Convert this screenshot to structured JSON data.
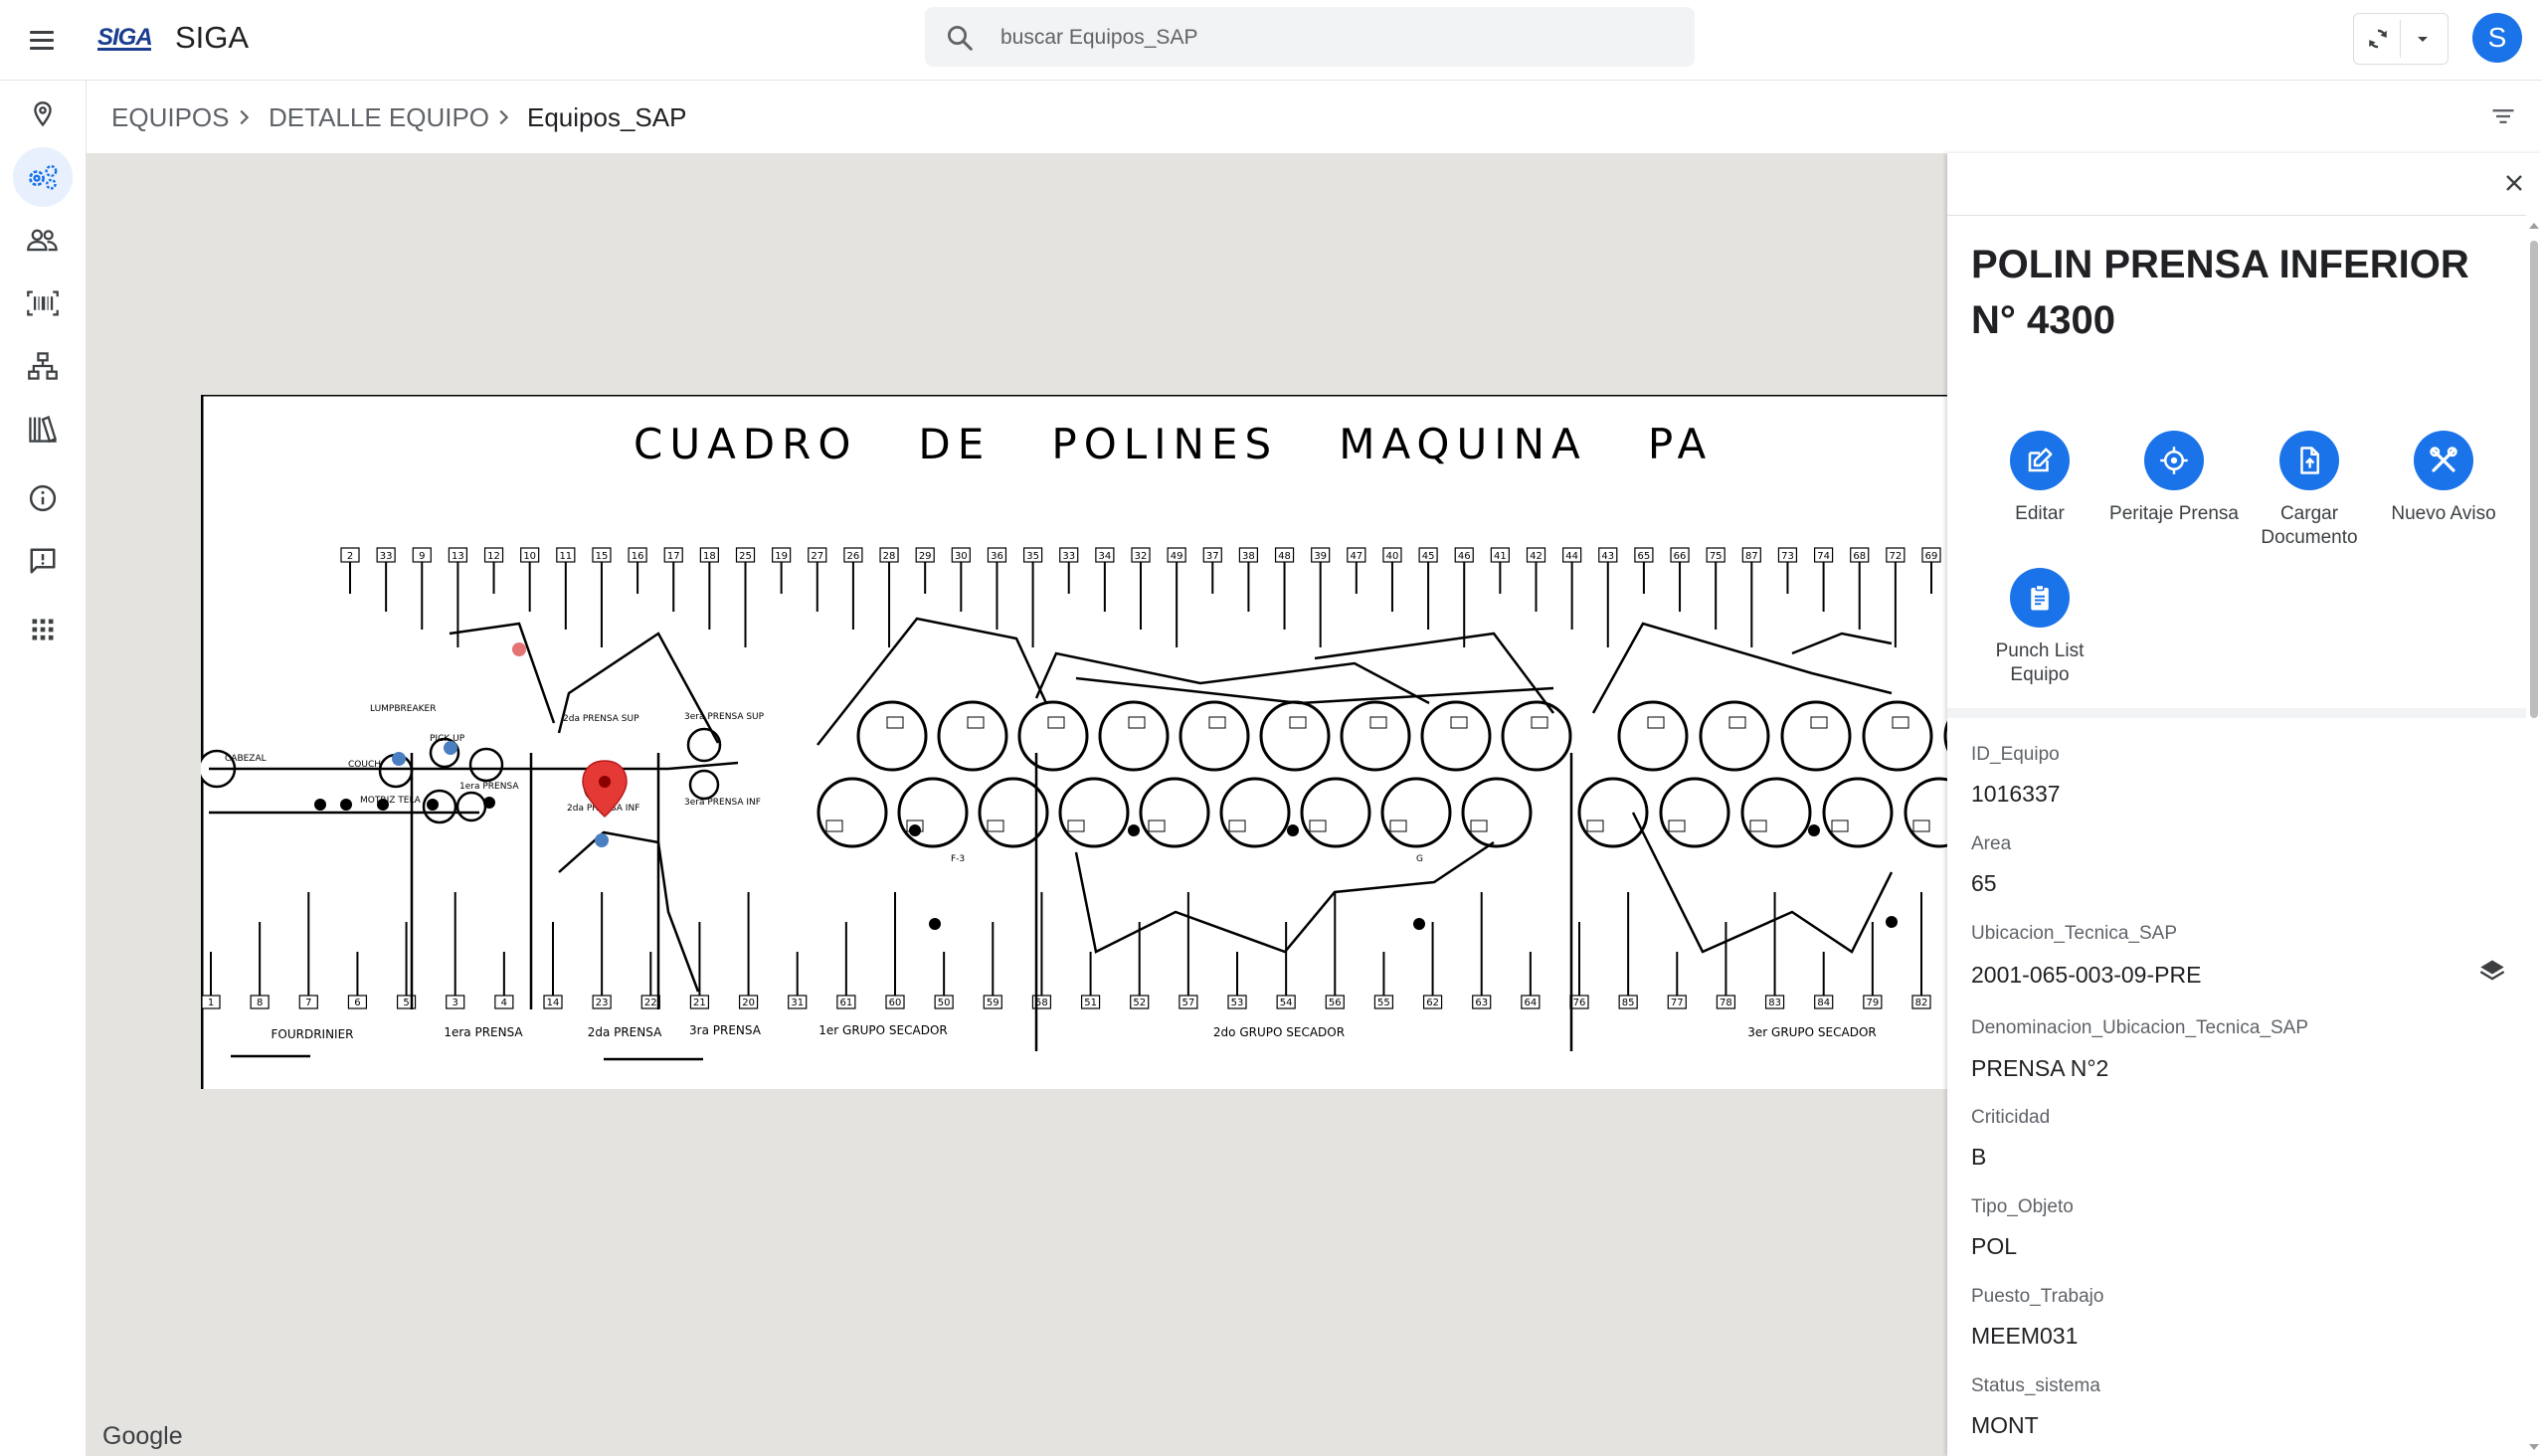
{
  "header": {
    "logo_text": "SIGA",
    "app_title": "SIGA",
    "search_placeholder": "buscar Equipos_SAP",
    "avatar_initial": "S"
  },
  "icons": {
    "menu": "menu-icon",
    "search": "search-icon",
    "sync": "sync-icon",
    "dropdown": "chevron-down-icon",
    "rail": [
      "map-pin-icon",
      "gears-icon",
      "users-icon",
      "barcode-icon",
      "hierarchy-icon",
      "library-icon",
      "info-icon",
      "feedback-icon",
      "apps-grid-icon"
    ],
    "filter": "filter-icon",
    "close": "close-icon",
    "layers": "layers-icon"
  },
  "breadcrumb": {
    "items": [
      "EQUIPOS",
      "DETALLE EQUIPO",
      "Equipos_SAP"
    ]
  },
  "map": {
    "attribution": "Google",
    "diagram": {
      "title": "CUADRO   DE   POLINES   MAQUINA   PA",
      "sections": [
        "FOURDRINIER",
        "1era PRENSA",
        "2da PRENSA",
        "3ra PRENSA",
        "1er GRUPO SECADOR",
        "2do GRUPO SECADOR",
        "3er GRUPO SECADOR"
      ],
      "labels": [
        "CABEZAL",
        "COUCH",
        "LUMPBREAKER",
        "PICK UP",
        "MOTRIZ TELA",
        "1era PRENSA",
        "2da PRENSA SUP",
        "2da PRENSA INF",
        "3era PRENSA SUP",
        "3era PRENSA INF",
        "F-3",
        "G"
      ],
      "top_numbers": [
        "2",
        "33",
        "9",
        "13",
        "12",
        "10",
        "11",
        "15",
        "16",
        "17",
        "18",
        "25",
        "19",
        "27",
        "26",
        "28",
        "29",
        "30",
        "36",
        "35",
        "33",
        "34",
        "32",
        "49",
        "37",
        "38",
        "48",
        "39",
        "47",
        "40",
        "45",
        "46",
        "41",
        "42",
        "44",
        "43",
        "65",
        "66",
        "75",
        "87",
        "73",
        "74",
        "68",
        "72",
        "69"
      ],
      "bottom_numbers": [
        "1",
        "8",
        "7",
        "6",
        "5",
        "3",
        "4",
        "14",
        "23",
        "22",
        "21",
        "20",
        "31",
        "61",
        "60",
        "50",
        "59",
        "58",
        "51",
        "52",
        "57",
        "53",
        "54",
        "56",
        "55",
        "62",
        "63",
        "64",
        "76",
        "85",
        "77",
        "78",
        "83",
        "84",
        "79",
        "82"
      ]
    }
  },
  "panel": {
    "title": "POLIN PRENSA INFERIOR N° 4300",
    "actions": [
      {
        "label": "Editar",
        "icon": "edit-icon"
      },
      {
        "label": "Peritaje Prensa",
        "icon": "crosshair-icon"
      },
      {
        "label": "Cargar Documento",
        "icon": "upload-document-icon"
      },
      {
        "label": "Nuevo Aviso",
        "icon": "tools-icon"
      },
      {
        "label": "Punch List Equipo",
        "icon": "clipboard-icon"
      }
    ],
    "fields": [
      {
        "label": "ID_Equipo",
        "value": "1016337"
      },
      {
        "label": "Area",
        "value": "65"
      },
      {
        "label": "Ubicacion_Tecnica_SAP",
        "value": "2001-065-003-09-PRE"
      },
      {
        "label": "Denominacion_Ubicacion_Tecnica_SAP",
        "value": "PRENSA N°2"
      },
      {
        "label": "Criticidad",
        "value": "B"
      },
      {
        "label": "Tipo_Objeto",
        "value": "POL"
      },
      {
        "label": "Puesto_Trabajo",
        "value": "MEEM031"
      },
      {
        "label": "Status_sistema",
        "value": "MONT"
      }
    ]
  },
  "colors": {
    "accent": "#1a73e8",
    "marker_red": "#e53935",
    "marker_blue": "#4a7fc1",
    "map_bg": "#e5e3df"
  }
}
